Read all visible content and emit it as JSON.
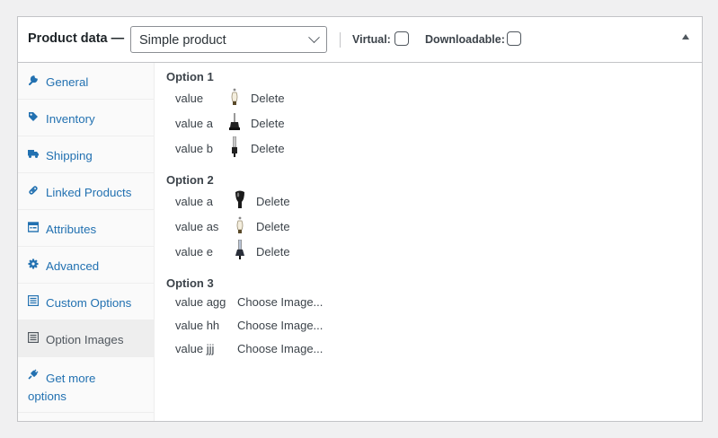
{
  "header": {
    "title": "Product data —",
    "product_type": "Simple product",
    "virtual_label": "Virtual:",
    "downloadable_label": "Downloadable:"
  },
  "sidebar": {
    "items": [
      {
        "label": "General",
        "icon": "wrench-icon"
      },
      {
        "label": "Inventory",
        "icon": "tag-icon"
      },
      {
        "label": "Shipping",
        "icon": "truck-icon"
      },
      {
        "label": "Linked Products",
        "icon": "link-icon"
      },
      {
        "label": "Attributes",
        "icon": "table-icon"
      },
      {
        "label": "Advanced",
        "icon": "gear-icon"
      },
      {
        "label": "Custom Options",
        "icon": "list-icon"
      },
      {
        "label": "Option Images",
        "icon": "list-icon"
      },
      {
        "label": "Get more options",
        "icon": "plugin-icon"
      }
    ],
    "active_index": 7
  },
  "options": [
    {
      "title": "Option 1",
      "values": [
        {
          "value": "value",
          "image": "bulb-icon",
          "action": "Delete"
        },
        {
          "value": "value a",
          "image": "lamp-base-icon",
          "action": "Delete"
        },
        {
          "value": "value b",
          "image": "lamp-tube-icon",
          "action": "Delete"
        }
      ]
    },
    {
      "title": "Option 2",
      "values": [
        {
          "value": "value a",
          "image": "lamp-dark-icon",
          "action": "Delete"
        },
        {
          "value": "value as",
          "image": "bulb-icon",
          "action": "Delete"
        },
        {
          "value": "value e",
          "image": "lamp-tube-icon",
          "action": "Delete"
        }
      ]
    },
    {
      "title": "Option 3",
      "values": [
        {
          "value": "value agg",
          "image": null,
          "action": "Choose Image..."
        },
        {
          "value": "value hh",
          "image": null,
          "action": "Choose Image..."
        },
        {
          "value": "value jjj",
          "image": null,
          "action": "Choose Image..."
        }
      ]
    }
  ],
  "colors": {
    "link": "#2271b1",
    "text": "#3c434a",
    "active_tab_bg": "#eeeeee",
    "border": "#c3c4c7"
  }
}
